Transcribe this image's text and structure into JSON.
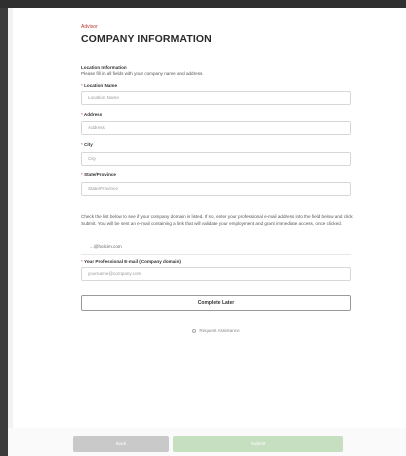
{
  "breadcrumb": "Advisor",
  "page_title": "COMPANY INFORMATION",
  "section": {
    "title": "Location Information",
    "description": "Please fill in all fields with your company name and address."
  },
  "fields": {
    "location_name": {
      "label": "Location Name",
      "placeholder": "Location Name",
      "required_mark": "*"
    },
    "address": {
      "label": "Address",
      "placeholder": "Address",
      "required_mark": "*"
    },
    "city": {
      "label": "City",
      "placeholder": "City",
      "required_mark": "*"
    },
    "state": {
      "label": "State/Province",
      "placeholder": "State/Province",
      "required_mark": "*"
    },
    "email": {
      "label": "Your Professional E-mail (Company domain)",
      "placeholder": "yourname@company.com",
      "required_mark": "*"
    }
  },
  "instructions": "Check the list below to see if your company domain is listed. If so, enter your professional e-mail address into the field below and click Submit. You will be sent an e-mail containing a link that will validate your employment and grant immediate access, once clicked.",
  "domain_list": [
    "...@holcim.com"
  ],
  "complete_later_label": "Complete Later",
  "request_assistance_label": "Request Assistance",
  "footer": {
    "back_label": "Back",
    "submit_label": "Submit"
  },
  "colors": {
    "required": "#c0392b",
    "submit_disabled": "#c6dfc1",
    "back_disabled": "#c9c9c9"
  },
  "icons": {
    "assist": "help-circle-icon"
  }
}
